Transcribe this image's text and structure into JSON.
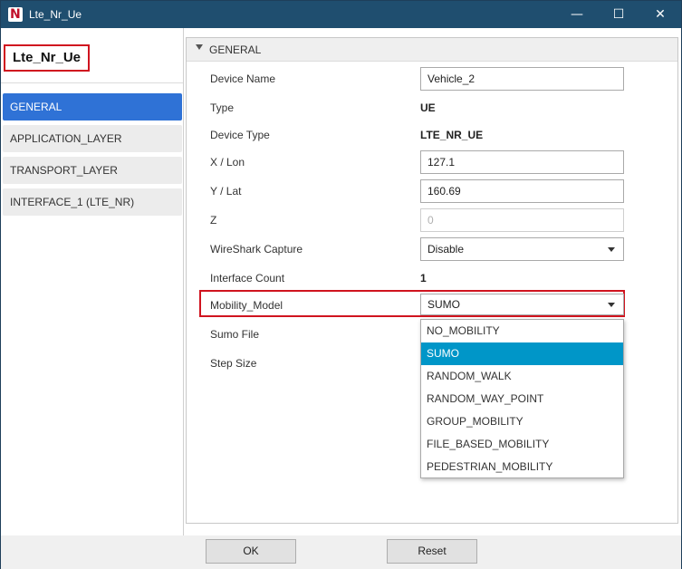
{
  "window": {
    "title": "Lte_Nr_Ue",
    "icon_letter": "N",
    "controls": {
      "minimize": "—",
      "maximize": "☐",
      "close": "✕"
    }
  },
  "device_title": "Lte_Nr_Ue",
  "nav": {
    "items": [
      {
        "label": "GENERAL",
        "active": true
      },
      {
        "label": "APPLICATION_LAYER",
        "active": false
      },
      {
        "label": "TRANSPORT_LAYER",
        "active": false
      },
      {
        "label": "INTERFACE_1 (LTE_NR)",
        "active": false
      }
    ]
  },
  "section": {
    "title": "GENERAL"
  },
  "fields": {
    "device_name": {
      "label": "Device Name",
      "value": "Vehicle_2"
    },
    "type": {
      "label": "Type",
      "value": "UE"
    },
    "device_type": {
      "label": "Device Type",
      "value": "LTE_NR_UE"
    },
    "x_lon": {
      "label": "X / Lon",
      "value": "127.1"
    },
    "y_lat": {
      "label": "Y / Lat",
      "value": "160.69"
    },
    "z": {
      "label": "Z",
      "value": "0"
    },
    "wireshark": {
      "label": "WireShark Capture",
      "value": "Disable"
    },
    "interface_count": {
      "label": "Interface Count",
      "value": "1"
    },
    "mobility_model": {
      "label": "Mobility_Model",
      "value": "SUMO"
    },
    "sumo_file": {
      "label": "Sumo File"
    },
    "step_size": {
      "label": "Step Size"
    }
  },
  "mobility_options": [
    "NO_MOBILITY",
    "SUMO",
    "RANDOM_WALK",
    "RANDOM_WAY_POINT",
    "GROUP_MOBILITY",
    "FILE_BASED_MOBILITY",
    "PEDESTRIAN_MOBILITY"
  ],
  "mobility_selected": "SUMO",
  "footer": {
    "ok_label": "OK",
    "reset_label": "Reset"
  },
  "colors": {
    "titlebar": "#1f4e6f",
    "nav_active": "#2f72d6",
    "dropdown_selected": "#0096c8",
    "highlight": "#d0141f"
  }
}
